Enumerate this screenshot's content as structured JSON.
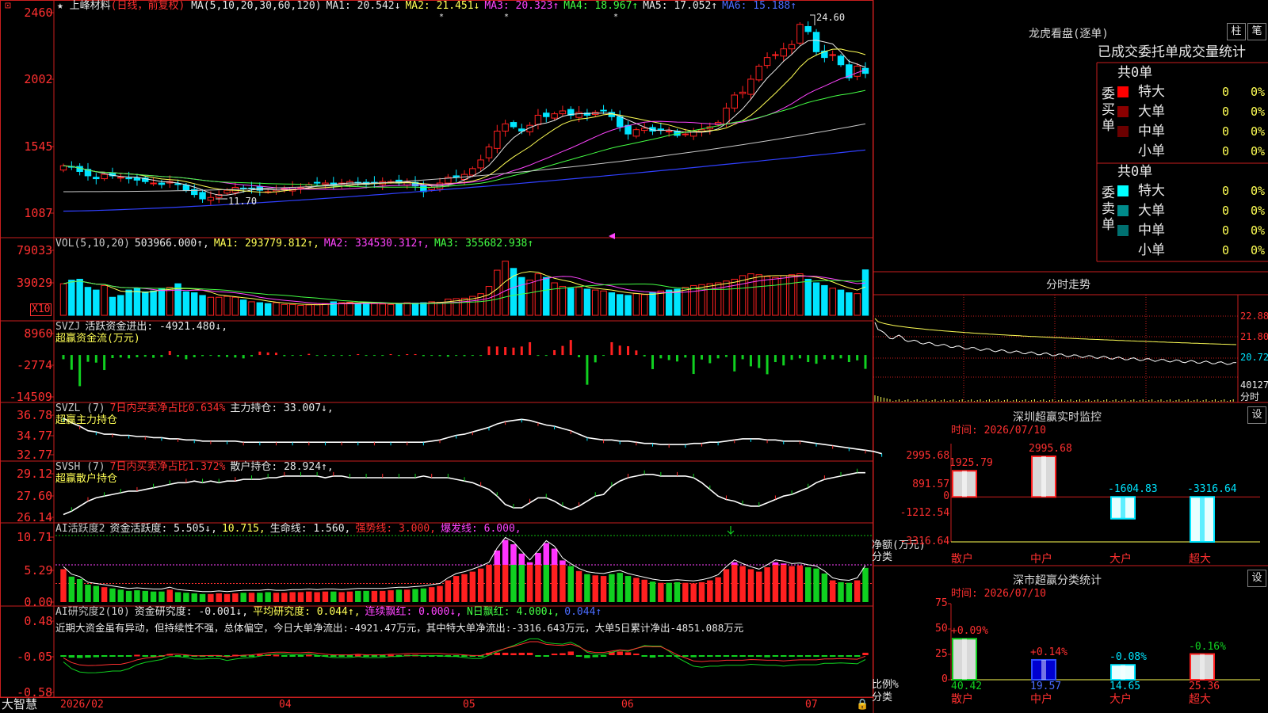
{
  "app": {
    "name": "大智慧"
  },
  "stock": {
    "name": "上峰材料",
    "mode": "(日线，前复权)",
    "star": "★"
  },
  "ma_legend": [
    {
      "label": "MA(5,10,20,30,60,120)",
      "color": "#e8e8e8"
    },
    {
      "label": "MA1: 20.542↓",
      "color": "#e8e8e8"
    },
    {
      "label": "MA2: 21.451↓",
      "color": "#ffff55"
    },
    {
      "label": "MA3: 20.323↑",
      "color": "#ff44ff"
    },
    {
      "label": "MA4: 18.967↑",
      "color": "#44ff44"
    },
    {
      "label": "MA5: 17.052↑",
      "color": "#e8e8e8"
    },
    {
      "label": "MA6: 15.188↑",
      "color": "#4a6cff"
    }
  ],
  "vol_legend": [
    {
      "label": "VOL(5,10,20)",
      "color": "#c8c8c8"
    },
    {
      "label": "503966.000↑,",
      "color": "#e8e8e8"
    },
    {
      "label": "MA1: 293779.812↑,",
      "color": "#ffff55"
    },
    {
      "label": "MA2: 334530.312↑,",
      "color": "#ff44ff"
    },
    {
      "label": "MA3: 355682.938↑",
      "color": "#44ff44"
    }
  ],
  "svzj_legend": [
    {
      "label": "SVZJ",
      "color": "#c8c8c8"
    },
    {
      "label": "活跃资金进出: -4921.480↓,",
      "color": "#e8e8e8"
    }
  ],
  "svzj_sub": "超赢资金流(万元)",
  "svzl_legend": [
    {
      "label": "SVZL (7)",
      "color": "#c8c8c8"
    },
    {
      "label": "7日内买卖净占比0.634%",
      "color": "#ff3030"
    },
    {
      "label": "主力持仓: 33.007↓,",
      "color": "#e8e8e8"
    }
  ],
  "svzl_sub": "超赢主力持仓",
  "svsh_legend": [
    {
      "label": "SVSH (7)",
      "color": "#c8c8c8"
    },
    {
      "label": "7日内买卖净占比1.372%",
      "color": "#ff3030"
    },
    {
      "label": "散户持仓: 28.924↑,",
      "color": "#e8e8e8"
    }
  ],
  "svsh_sub": "超赢散户持仓",
  "ai2_legend": [
    {
      "label": "AI活跃度2",
      "color": "#c8c8c8"
    },
    {
      "label": "资金活跃度: 5.505↓,",
      "color": "#e8e8e8"
    },
    {
      "label": "10.715,",
      "color": "#ffff55"
    },
    {
      "label": "生命线: 1.560,",
      "color": "#e8e8e8"
    },
    {
      "label": "强势线: 3.000,",
      "color": "#ff3030"
    },
    {
      "label": "爆发线: 6.000,",
      "color": "#ff44ff"
    }
  ],
  "ai3_legend": [
    {
      "label": "AI研究度2(10)",
      "color": "#c8c8c8"
    },
    {
      "label": "资金研究度: -0.001↓,",
      "color": "#e8e8e8"
    },
    {
      "label": "平均研究度: 0.044↑,",
      "color": "#ffff55"
    },
    {
      "label": "连续飘红: 0.000↓,",
      "color": "#ff44ff"
    },
    {
      "label": "N日飘红: 4.000↓,",
      "color": "#44ff44"
    },
    {
      "label": "0.044↑",
      "color": "#4a6cff"
    }
  ],
  "ai3_note": "近期大资金虽有异动，但持续性不强，总体偏空，今日大单净流出:-4921.47万元，其中特大单净流出:-3316.643万元，大单5日累计净出-4851.088万元",
  "x_axis": {
    "labels": [
      "2026/02",
      "04",
      "05",
      "06",
      "07"
    ]
  },
  "price_annotations": {
    "high": "24.60",
    "low": "11.70"
  },
  "y_labels": {
    "price": [
      "2460",
      "2002",
      "1545",
      "1087"
    ],
    "vol": [
      "79033",
      "39029",
      "X10"
    ],
    "svzj": [
      "8960",
      "-2774",
      "-14509"
    ],
    "svzl": [
      "36.78",
      "34.77",
      "32.77"
    ],
    "svsh": [
      "29.12",
      "27.60",
      "26.14"
    ],
    "ai2": [
      "10.71",
      "5.29",
      "0.00"
    ],
    "ai3": [
      "0.48",
      "-0.05",
      "-0.58"
    ]
  },
  "dragon_tiger": {
    "title": "龙虎看盘(逐单)",
    "tabs": [
      "柱",
      "笔"
    ],
    "header": "已成交委托单成交量统计",
    "buy": {
      "side": "委买单",
      "count": "共0单",
      "rows": [
        {
          "name": "特大",
          "value": "0",
          "pct": "0%",
          "color": "#ff0000"
        },
        {
          "name": "大单",
          "value": "0",
          "pct": "0%",
          "color": "#8b0000"
        },
        {
          "name": "中单",
          "value": "0",
          "pct": "0%",
          "color": "#6b0000"
        },
        {
          "name": "小单",
          "value": "0",
          "pct": "0%",
          "color": ""
        }
      ]
    },
    "sell": {
      "side": "委卖单",
      "count": "共0单",
      "rows": [
        {
          "name": "特大",
          "value": "0",
          "pct": "0%",
          "color": "#00ffff"
        },
        {
          "name": "大单",
          "value": "0",
          "pct": "0%",
          "color": "#008b8b"
        },
        {
          "name": "中单",
          "value": "0",
          "pct": "0%",
          "color": "#007070"
        },
        {
          "name": "小单",
          "value": "0",
          "pct": "0%",
          "color": ""
        }
      ]
    }
  },
  "intraday": {
    "title": "分时走势",
    "y_labels": [
      "22.88",
      "21.80",
      "20.72",
      "40127"
    ],
    "footer": "分时"
  },
  "sz_monitor": {
    "title": "深圳超赢实时监控",
    "settings": "设",
    "time": "时间: 2026/07/10",
    "axis_labels": [
      "2995.68",
      "891.57",
      "0",
      "-1212.54",
      "-3316.64"
    ],
    "unit": "净额(万元)",
    "category_label": "分类",
    "bars": [
      {
        "name": "散户",
        "value": 1925.79
      },
      {
        "name": "中户",
        "value": 2995.68
      },
      {
        "name": "大户",
        "value": -1604.83
      },
      {
        "name": "超大",
        "value": -3316.64
      }
    ]
  },
  "sz_stats": {
    "title": "深市超赢分类统计",
    "settings": "设",
    "time": "时间: 2026/07/10",
    "axis_labels": [
      "75",
      "50",
      "25",
      "0"
    ],
    "unit": "比例%",
    "category_label": "分类",
    "bars": [
      {
        "name": "散户",
        "value": 40.42,
        "change": "+0.09%"
      },
      {
        "name": "中户",
        "value": 19.57,
        "change": "+0.14%"
      },
      {
        "name": "大户",
        "value": 14.65,
        "change": "-0.08%"
      },
      {
        "name": "超大",
        "value": 25.36,
        "change": "-0.16%"
      }
    ]
  },
  "chart_data": [
    {
      "type": "candlestick",
      "title": "上峰材料 (日线，前复权)",
      "x_range": [
        "2026/02",
        "2026/07/10"
      ],
      "ylim": [
        10.87,
        24.6
      ],
      "markers": {
        "high": 24.6,
        "low": 11.7
      },
      "closes": [
        14.1,
        14.0,
        13.7,
        13.4,
        13.2,
        13.5,
        13.4,
        13.3,
        13.2,
        13.1,
        13.0,
        12.9,
        12.8,
        13.0,
        12.8,
        12.4,
        12.1,
        11.8,
        11.9,
        12.1,
        12.4,
        12.6,
        12.5,
        12.5,
        12.4,
        12.3,
        12.4,
        12.5,
        12.6,
        12.6,
        12.8,
        12.9,
        12.9,
        12.8,
        12.9,
        13.0,
        12.9,
        12.8,
        12.9,
        13.0,
        13.0,
        12.9,
        13.0,
        12.7,
        12.3,
        12.6,
        12.9,
        13.3,
        13.3,
        13.5,
        13.9,
        14.5,
        15.4,
        16.5,
        17.0,
        16.8,
        16.5,
        16.9,
        17.6,
        17.5,
        17.7,
        17.9,
        17.6,
        17.8,
        17.6,
        17.8,
        17.9,
        17.5,
        16.8,
        16.3,
        16.6,
        16.7,
        16.5,
        16.6,
        16.5,
        16.2,
        16.3,
        16.5,
        16.6,
        16.8,
        17.1,
        18.1,
        19.0,
        19.2,
        20.1,
        21.0,
        21.6,
        21.8,
        22.2,
        22.5,
        23.9,
        23.4,
        22.0,
        21.6,
        21.8,
        21.1,
        20.2,
        21.0,
        20.5
      ],
      "ma_latest": {
        "MA1": 20.542,
        "MA2": 21.451,
        "MA3": 20.323,
        "MA4": 18.967,
        "MA5": 17.052,
        "MA6": 15.188
      }
    },
    {
      "type": "bar",
      "title": "VOL(5,10,20)",
      "ylim": [
        0,
        79033
      ],
      "values": [
        35000,
        39000,
        40000,
        31000,
        28000,
        33000,
        20000,
        22000,
        28000,
        30000,
        26000,
        27000,
        29000,
        31000,
        35000,
        26000,
        25000,
        22000,
        20000,
        20000,
        21000,
        20000,
        17000,
        15000,
        14000,
        13000,
        14000,
        12000,
        12000,
        11000,
        11500,
        12000,
        13000,
        15000,
        14000,
        14500,
        13000,
        14500,
        13000,
        12500,
        12000,
        13000,
        14000,
        13500,
        14000,
        15000,
        14500,
        18000,
        18500,
        19000,
        21000,
        24000,
        32000,
        50000,
        60000,
        52000,
        42000,
        39000,
        46000,
        42000,
        36000,
        32000,
        30000,
        31000,
        29000,
        28000,
        27000,
        25000,
        23000,
        22000,
        24000,
        23000,
        25000,
        27000,
        28000,
        29000,
        31000,
        33000,
        34000,
        35000,
        36000,
        38000,
        40000,
        44000,
        46000,
        45000,
        43000,
        42000,
        44000,
        45000,
        46000,
        40000,
        36000,
        33000,
        30000,
        28000,
        25000,
        24000,
        50400
      ],
      "last_value": 503966.0
    },
    {
      "type": "bar",
      "title": "SVZJ 活跃资金进出",
      "ylim": [
        -14509,
        8960
      ],
      "values": [
        -1500,
        -5200,
        -11000,
        -2400,
        -2700,
        -5300,
        -1100,
        -900,
        -1200,
        -800,
        -600,
        -1000,
        -700,
        1400,
        -600,
        -1500,
        -800,
        -400,
        -300,
        -600,
        -700,
        -900,
        -1200,
        -500,
        1200,
        900,
        800,
        -400,
        -300,
        -200,
        400,
        -300,
        -300,
        -300,
        -300,
        -200,
        300,
        -300,
        -200,
        -300,
        300,
        -300,
        300,
        300,
        -400,
        -300,
        -400,
        -600,
        -300,
        -400,
        -300,
        -300,
        3000,
        3000,
        2800,
        2600,
        3000,
        4500,
        -300,
        -300,
        1700,
        3200,
        5300,
        -800,
        -10500,
        -2600,
        -300,
        4500,
        3300,
        3100,
        1600,
        -500,
        -5000,
        -1200,
        -1800,
        -2300,
        -900,
        -6700,
        -1600,
        -2900,
        -1200,
        -700,
        -5800,
        -1500,
        -4000,
        -4600,
        -6800,
        -2500,
        -3700,
        -1700,
        -1200,
        -2500,
        -3100,
        -1500,
        -1600,
        -1200,
        -2500,
        -1900,
        -4900
      ],
      "last_value": -4921.48
    },
    {
      "type": "line",
      "title": "SVZL 主力持仓",
      "ylim": [
        32.77,
        36.78
      ],
      "values": [
        36.1,
        35.7,
        35.4,
        35.0,
        34.9,
        34.7,
        34.7,
        34.6,
        34.6,
        34.5,
        34.5,
        34.4,
        34.4,
        34.3,
        34.3,
        34.2,
        34.2,
        34.1,
        34.1,
        34.1,
        34.1,
        34.1,
        34.0,
        34.0,
        34.0,
        34.0,
        34.0,
        34.0,
        34.0,
        34.0,
        34.0,
        34.0,
        34.0,
        34.0,
        34.0,
        34.0,
        34.0,
        34.0,
        34.0,
        34.0,
        34.0,
        34.0,
        34.0,
        34.0,
        34.0,
        34.1,
        34.2,
        34.4,
        34.6,
        34.7,
        34.9,
        35.1,
        35.3,
        35.6,
        35.8,
        35.9,
        36.0,
        35.9,
        35.7,
        35.5,
        35.4,
        35.2,
        35.0,
        34.7,
        34.4,
        34.3,
        34.2,
        34.2,
        34.1,
        34.1,
        34.0,
        33.9,
        33.9,
        33.8,
        33.8,
        33.8,
        33.8,
        33.9,
        33.9,
        34.0,
        34.0,
        34.1,
        34.2,
        34.3,
        34.3,
        34.3,
        34.2,
        34.2,
        34.1,
        34.1,
        34.1,
        34.0,
        33.9,
        33.8,
        33.7,
        33.6,
        33.5,
        33.4,
        33.3,
        33.2,
        33.0
      ],
      "last_value": 33.007
    },
    {
      "type": "line",
      "title": "SVSH 散户持仓",
      "ylim": [
        26.14,
        29.12
      ],
      "values": [
        26.4,
        26.6,
        26.9,
        27.2,
        27.4,
        27.5,
        27.6,
        27.7,
        27.8,
        27.8,
        27.9,
        28.0,
        28.1,
        28.2,
        28.3,
        28.3,
        28.4,
        28.3,
        28.4,
        28.3,
        28.4,
        28.4,
        28.5,
        28.5,
        28.5,
        28.6,
        28.6,
        28.7,
        28.7,
        28.7,
        28.7,
        28.7,
        28.6,
        28.7,
        28.7,
        28.6,
        28.6,
        28.6,
        28.6,
        28.6,
        28.6,
        28.6,
        28.6,
        28.6,
        28.7,
        28.6,
        28.6,
        28.6,
        28.5,
        28.4,
        28.3,
        28.1,
        27.9,
        27.5,
        27.0,
        26.8,
        26.8,
        27.1,
        27.4,
        27.4,
        27.2,
        26.9,
        26.7,
        26.9,
        27.2,
        27.5,
        27.6,
        28.1,
        28.4,
        28.6,
        28.7,
        28.8,
        28.8,
        28.7,
        28.7,
        28.7,
        28.7,
        28.6,
        28.3,
        27.9,
        27.5,
        27.3,
        27.2,
        27.0,
        26.9,
        26.9,
        27.1,
        27.3,
        27.5,
        27.6,
        27.8,
        28.0,
        28.3,
        28.5,
        28.6,
        28.7,
        28.8,
        28.9,
        28.9
      ],
      "last_value": 28.924
    },
    {
      "type": "bar",
      "title": "AI活跃度2 资金活跃度",
      "ylim": [
        0,
        10.71
      ],
      "values": [
        5.3,
        4.1,
        3.7,
        2.8,
        2.6,
        2.4,
        2.2,
        2.0,
        1.8,
        1.9,
        1.8,
        1.7,
        1.7,
        2.0,
        1.6,
        1.5,
        1.4,
        1.3,
        1.3,
        1.4,
        1.3,
        1.4,
        1.5,
        1.5,
        1.5,
        1.6,
        1.5,
        1.5,
        1.6,
        1.6,
        1.7,
        1.6,
        1.7,
        1.7,
        1.6,
        1.7,
        1.8,
        1.8,
        1.8,
        1.8,
        1.9,
        2.0,
        2.0,
        2.1,
        2.2,
        2.4,
        2.6,
        3.5,
        4.2,
        4.5,
        4.9,
        5.4,
        6.0,
        8.3,
        10.0,
        9.3,
        7.8,
        6.4,
        7.9,
        9.5,
        8.6,
        6.7,
        5.8,
        5.0,
        4.5,
        4.3,
        4.2,
        4.5,
        4.7,
        4.2,
        3.9,
        3.6,
        3.3,
        3.1,
        3.1,
        3.2,
        3.1,
        3.0,
        3.2,
        3.5,
        4.0,
        5.3,
        6.4,
        5.8,
        5.3,
        4.9,
        5.6,
        6.4,
        6.2,
        5.8,
        5.9,
        5.6,
        5.4,
        4.6,
        3.5,
        3.2,
        3.1,
        3.5,
        5.5
      ],
      "last_value": 5.505
    },
    {
      "type": "bar",
      "title": "AI研究度2(10) 资金研究度",
      "ylim": [
        -0.58,
        0.48
      ],
      "values": [
        -0.02,
        -0.06,
        -0.07,
        -0.06,
        -0.05,
        -0.04,
        -0.03,
        -0.02,
        -0.01,
        0.01,
        -0.01,
        -0.02,
        -0.01,
        0.03,
        -0.02,
        -0.03,
        -0.02,
        -0.01,
        -0.01,
        -0.01,
        -0.01,
        0.01,
        -0.01,
        -0.01,
        0.02,
        0.02,
        0.01,
        -0.01,
        -0.01,
        -0.01,
        0.01,
        -0.01,
        -0.01,
        -0.01,
        -0.01,
        -0.01,
        0.01,
        -0.01,
        -0.01,
        -0.01,
        0.01,
        -0.01,
        0.01,
        0.01,
        -0.01,
        -0.01,
        -0.01,
        -0.01,
        -0.01,
        -0.01,
        -0.01,
        -0.01,
        0.06,
        0.06,
        0.06,
        0.05,
        0.06,
        0.06,
        -0.01,
        -0.02,
        0.04,
        0.05,
        0.09,
        -0.02,
        -0.07,
        -0.05,
        -0.02,
        0.08,
        0.09,
        0.07,
        0.04,
        -0.01,
        -0.06,
        -0.02,
        -0.03,
        -0.04,
        -0.02,
        -0.05,
        -0.03,
        -0.04,
        -0.02,
        -0.01,
        -0.04,
        -0.02,
        -0.03,
        -0.04,
        -0.05,
        -0.02,
        -0.03,
        -0.02,
        -0.01,
        -0.03,
        -0.04,
        -0.02,
        -0.02,
        -0.02,
        -0.03,
        -0.02,
        0.06
      ],
      "last_value": -0.001
    }
  ]
}
